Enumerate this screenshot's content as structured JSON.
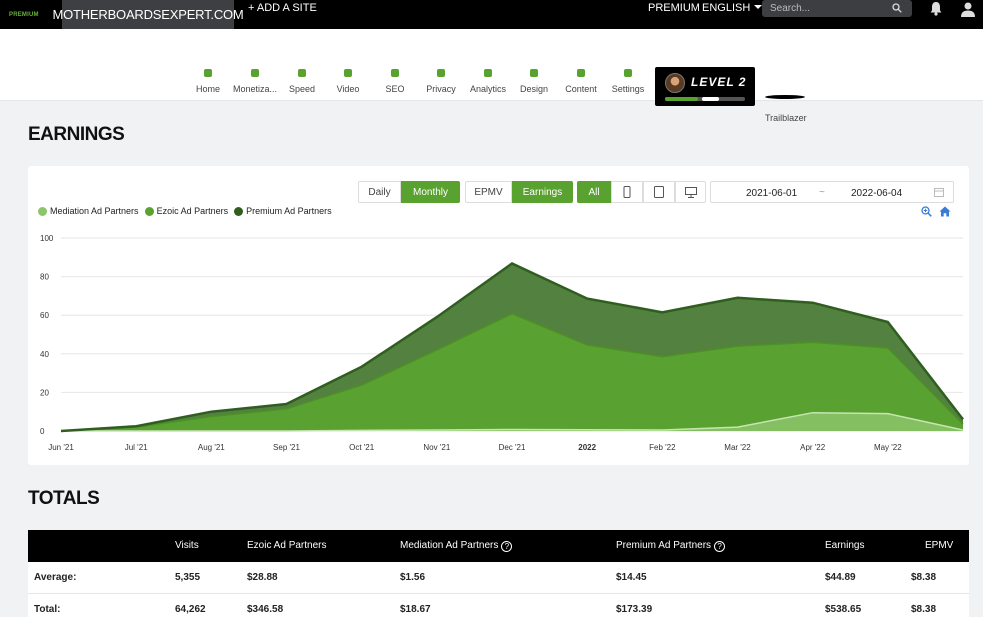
{
  "topbar": {
    "premium_tag": "PREMIUM",
    "site_name": "MOTHERBOARDSEXPERT.COM",
    "add_site": "+ ADD A SITE",
    "premium": "PREMIUM",
    "language": "ENGLISH",
    "search_placeholder": "Search...",
    "icons": [
      "search-icon",
      "bell-icon",
      "user-icon"
    ]
  },
  "nav": {
    "items": [
      {
        "label": "Home"
      },
      {
        "label": "Monetiza..."
      },
      {
        "label": "Speed"
      },
      {
        "label": "Video"
      },
      {
        "label": "SEO"
      },
      {
        "label": "Privacy"
      },
      {
        "label": "Analytics"
      },
      {
        "label": "Design"
      },
      {
        "label": "Content"
      },
      {
        "label": "Settings"
      }
    ],
    "status_color": "#5aa22f",
    "level": {
      "text": "LEVEL 2",
      "progress": 0.63
    },
    "badge_label": "Trailblazer"
  },
  "earnings": {
    "heading": "EARNINGS",
    "period_buttons": [
      {
        "label": "Daily",
        "active": false
      },
      {
        "label": "Monthly",
        "active": true
      }
    ],
    "metric_buttons": [
      {
        "label": "EPMV",
        "active": false
      },
      {
        "label": "Earnings",
        "active": true
      }
    ],
    "device_buttons": [
      {
        "label": "All",
        "active": true
      },
      {
        "icon": "phone-icon"
      },
      {
        "icon": "tablet-icon"
      },
      {
        "icon": "desktop-icon"
      }
    ],
    "date_start": "2021-06-01",
    "date_sep": "~",
    "date_end": "2022-06-04"
  },
  "chart_data": {
    "type": "area",
    "stacked": true,
    "title": "",
    "xlabel": "",
    "ylabel": "",
    "ylim": [
      0,
      100
    ],
    "yticks": [
      0,
      20,
      40,
      60,
      80,
      100
    ],
    "grid": true,
    "legend_position": "top-left",
    "x": [
      0,
      1,
      2,
      3,
      4,
      5,
      6,
      7,
      8,
      9,
      10,
      11,
      12
    ],
    "x_tick_labels": [
      "Jun '21",
      "Jul '21",
      "Aug '21",
      "Sep '21",
      "Oct '21",
      "Nov '21",
      "Dec '21",
      "2022",
      "Feb '22",
      "Mar '22",
      "Apr '22",
      "May '22",
      ""
    ],
    "series": [
      {
        "name": "Mediation Ad Partners",
        "color": "#8cc56a",
        "values": [
          0,
          0,
          0,
          0,
          0.3,
          0.5,
          0.8,
          0.6,
          0.5,
          2,
          9.5,
          9,
          0.5
        ]
      },
      {
        "name": "Ezoic Ad Partners",
        "color": "#5aa22f",
        "values": [
          0,
          2,
          7.5,
          11.5,
          23.5,
          41.5,
          60,
          44,
          38,
          42,
          36.5,
          34,
          3
        ]
      },
      {
        "name": "Premium Ad Partners",
        "color": "#4a7a35",
        "values": [
          0,
          0.5,
          2.5,
          2.5,
          9.5,
          17,
          26,
          24,
          23,
          25,
          20.5,
          13.5,
          2.5
        ]
      }
    ]
  },
  "totals": {
    "heading": "TOTALS",
    "columns": [
      "",
      "Visits",
      "Ezoic Ad Partners",
      "Mediation Ad Partners",
      "Premium Ad Partners",
      "Earnings",
      "EPMV"
    ],
    "rows": [
      [
        "Average:",
        "5,355",
        "$28.88",
        "$1.56",
        "$14.45",
        "$44.89",
        "$8.38"
      ],
      [
        "Total:",
        "64,262",
        "$346.58",
        "$18.67",
        "$173.39",
        "$538.65",
        "$8.38"
      ]
    ]
  }
}
